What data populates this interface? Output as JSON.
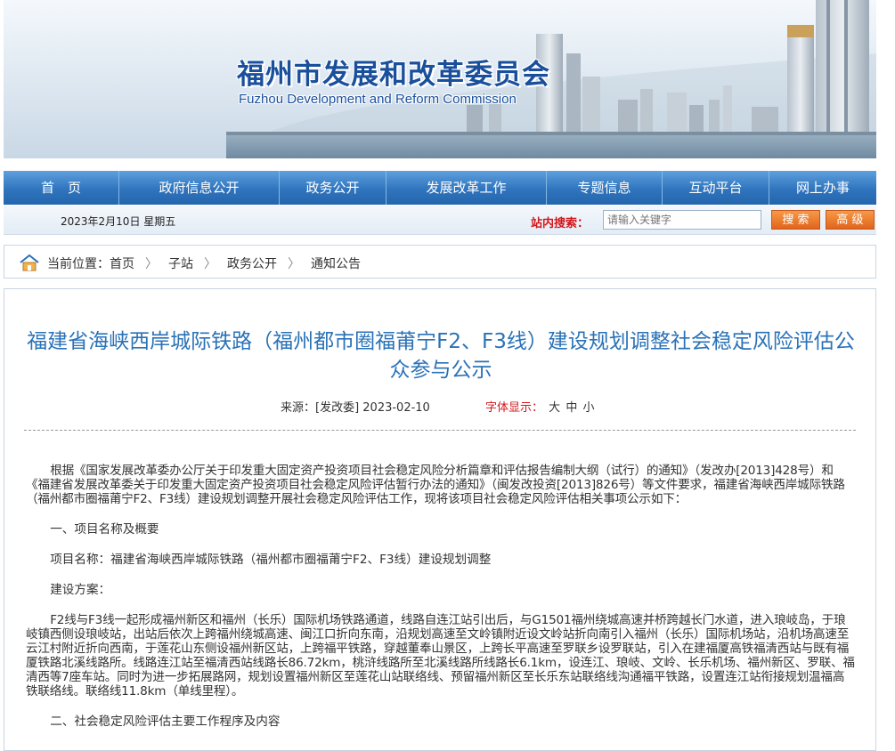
{
  "banner": {
    "title_cn": "福州市发展和改革委员会",
    "title_en": "Fuzhou Development and Reform Commission"
  },
  "nav": {
    "items": [
      {
        "label": "首　页"
      },
      {
        "label": "政府信息公开"
      },
      {
        "label": "政务公开"
      },
      {
        "label": "发展改革工作"
      },
      {
        "label": "专题信息"
      },
      {
        "label": "互动平台"
      },
      {
        "label": "网上办事"
      }
    ]
  },
  "infobar": {
    "date": "2023年2月10日 星期五",
    "search_label": "站内搜索：",
    "search_placeholder": "请输入关键字",
    "search_button": "搜 索",
    "advanced_button": "高 级"
  },
  "breadcrumb": {
    "prefix": "当前位置：",
    "items": [
      "首页",
      "子站",
      "政务公开",
      "通知公告"
    ]
  },
  "article": {
    "title": "福建省海峡西岸城际铁路（福州都市圈福莆宁F2、F3线）建设规划调整社会稳定风险评估公众参与公示",
    "source": "来源：[发改委] 2023-02-10",
    "font_label": "字体显示：",
    "font_sizes": [
      "大",
      "中",
      "小"
    ],
    "paragraphs": {
      "p1": "根据《国家发展改革委办公厅关于印发重大固定资产投资项目社会稳定风险分析篇章和评估报告编制大纲（试行）的通知》（发改办[2013]428号）和《福建省发展改革委关于印发重大固定资产投资项目社会稳定风险评估暂行办法的通知》（闽发改投资[2013]826号）等文件要求，福建省海峡西岸城际铁路（福州都市圈福莆宁F2、F3线）建设规划调整开展社会稳定风险评估工作，现将该项目社会稳定风险评估相关事项公示如下：",
      "h1": "一、项目名称及概要",
      "p2": "项目名称：福建省海峡西岸城际铁路（福州都市圈福莆宁F2、F3线）建设规划调整",
      "p3": "建设方案：",
      "p4": "F2线与F3线一起形成福州新区和福州（长乐）国际机场铁路通道，线路自连江站引出后，与G1501福州绕城高速并桥跨越长门水道，进入琅岐岛，于琅岐镇西侧设琅岐站，出站后依次上跨福州绕城高速、闽江口折向东南，沿规划高速至文岭镇附近设文岭站折向南引入福州（长乐）国际机场站，沿机场高速至云江村附近折向西南，于莲花山东侧设福州新区站，上跨福平铁路，穿越董奉山景区，上跨长平高速至罗联乡设罗联站，引入在建福厦高铁福清西站与既有福厦铁路北溪线路所。线路连江站至福清西站线路长86.72km，桃浒线路所至北溪线路所线路长6.1km，设连江、琅岐、文岭、长乐机场、福州新区、罗联、福清西等7座车站。同时为进一步拓展路网，规划设置福州新区至莲花山站联络线、预留福州新区至长乐东站联络线沟通福平铁路，设置连江站衔接规划温福高铁联络线。联络线11.8km（单线里程）。",
      "h2": "二、社会稳定风险评估主要工作程序及内容"
    }
  }
}
